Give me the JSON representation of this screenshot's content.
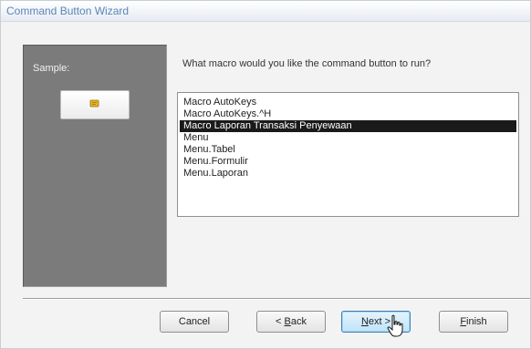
{
  "window": {
    "title": "Command Button Wizard"
  },
  "sample": {
    "label": "Sample:",
    "icon": "macro-scroll-icon"
  },
  "prompt": "What macro would you like the command button to run?",
  "macros": {
    "items": [
      "Macro AutoKeys",
      "Macro AutoKeys.^H",
      "Macro Laporan Transaksi Penyewaan",
      "Menu",
      "Menu.Tabel",
      "Menu.Formulir",
      "Menu.Laporan"
    ],
    "selected_index": 2
  },
  "buttons": {
    "cancel": {
      "label": "Cancel"
    },
    "back": {
      "prefix": "< ",
      "mnemonic": "B",
      "rest": "ack"
    },
    "next": {
      "mnemonic": "N",
      "rest": "ext >"
    },
    "finish": {
      "mnemonic": "F",
      "rest": "inish"
    }
  },
  "colors": {
    "title": "#5b86b7",
    "sample_panel": "#7b7b7b",
    "selection": "#1a1a1a",
    "default_button_border": "#3c7fb1"
  }
}
